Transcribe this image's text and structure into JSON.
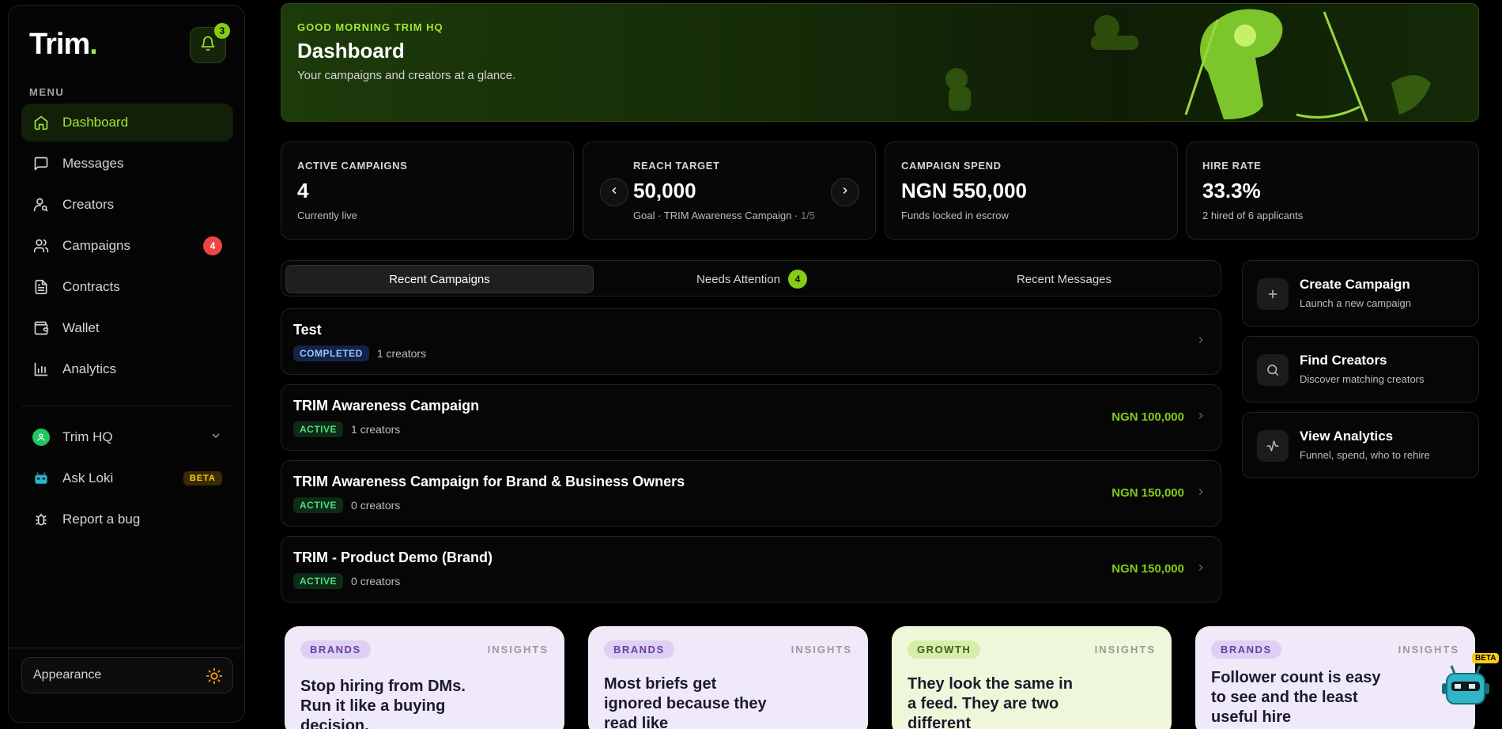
{
  "brand": {
    "name": "Trim",
    "dot": "."
  },
  "notifications": {
    "count": "3"
  },
  "sidebar": {
    "menu_label": "MENU",
    "items": [
      {
        "label": "Dashboard",
        "icon": "home-icon",
        "active": true
      },
      {
        "label": "Messages",
        "icon": "message-icon"
      },
      {
        "label": "Creators",
        "icon": "user-search-icon"
      },
      {
        "label": "Campaigns",
        "icon": "users-icon",
        "badge": "4"
      },
      {
        "label": "Contracts",
        "icon": "document-icon"
      },
      {
        "label": "Wallet",
        "icon": "wallet-icon"
      },
      {
        "label": "Analytics",
        "icon": "bar-chart-icon"
      }
    ],
    "account": {
      "label": "Trim HQ"
    },
    "ask_loki": {
      "label": "Ask Loki",
      "badge": "BETA"
    },
    "report_bug": {
      "label": "Report a bug"
    },
    "appearance": {
      "label": "Appearance"
    }
  },
  "hero": {
    "greeting": "GOOD MORNING TRIM HQ",
    "title": "Dashboard",
    "subtitle": "Your campaigns and creators at a glance."
  },
  "stats": [
    {
      "label": "ACTIVE CAMPAIGNS",
      "value": "4",
      "sub": "Currently live"
    },
    {
      "label": "REACH TARGET",
      "value": "50,000",
      "sub": "Goal · TRIM Awareness Campaign · ",
      "sub_page": "1/5"
    },
    {
      "label": "CAMPAIGN SPEND",
      "value": "NGN 550,000",
      "sub": "Funds locked in escrow"
    },
    {
      "label": "HIRE RATE",
      "value": "33.3%",
      "sub": "2 hired of 6 applicants"
    }
  ],
  "tabs": [
    {
      "label": "Recent Campaigns",
      "active": true
    },
    {
      "label": "Needs Attention",
      "count": "4"
    },
    {
      "label": "Recent Messages"
    }
  ],
  "campaigns": [
    {
      "title": "Test",
      "status": "COMPLETED",
      "creators": "1 creators",
      "amount": ""
    },
    {
      "title": "TRIM Awareness Campaign",
      "status": "ACTIVE",
      "creators": "1 creators",
      "amount": "NGN 100,000"
    },
    {
      "title": "TRIM Awareness Campaign for Brand & Business Owners",
      "status": "ACTIVE",
      "creators": "0 creators",
      "amount": "NGN 150,000"
    },
    {
      "title": "TRIM - Product Demo (Brand)",
      "status": "ACTIVE",
      "creators": "0 creators",
      "amount": "NGN 150,000"
    }
  ],
  "quick_actions": [
    {
      "title": "Create Campaign",
      "sub": "Launch a new campaign",
      "icon": "plus-icon"
    },
    {
      "title": "Find Creators",
      "sub": "Discover matching creators",
      "icon": "search-icon"
    },
    {
      "title": "View Analytics",
      "sub": "Funnel, spend, who to rehire",
      "icon": "activity-icon"
    }
  ],
  "insights": [
    {
      "tag": "BRANDS",
      "kind": "INSIGHTS",
      "text": "Stop hiring from DMs. Run it like a buying decision."
    },
    {
      "tag": "BRANDS",
      "kind": "INSIGHTS",
      "text": "Most briefs get ignored because they read like"
    },
    {
      "tag": "GROWTH",
      "kind": "INSIGHTS",
      "text": "They look the same in a feed. They are two different"
    },
    {
      "tag": "BRANDS",
      "kind": "INSIGHTS",
      "text": "Follower count is easy to see and the least useful hire"
    }
  ],
  "loki_fab": {
    "badge": "BETA"
  },
  "colors": {
    "accent": "#a3e635",
    "accent_strong": "#84cc16",
    "danger": "#ef4444",
    "background": "#000000"
  }
}
